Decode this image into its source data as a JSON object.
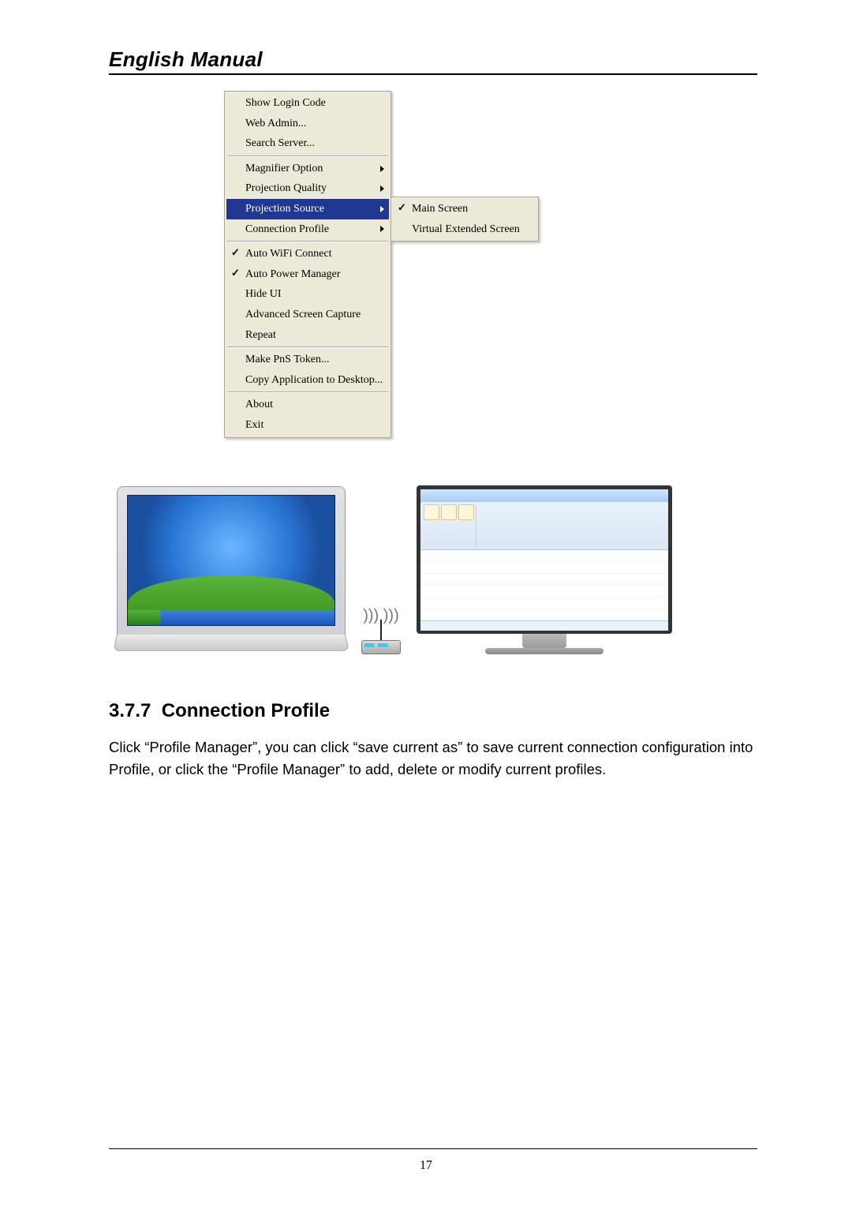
{
  "header": {
    "title": "English Manual"
  },
  "menu": {
    "items": [
      {
        "kind": "item",
        "label": "Show Login Code",
        "checked": false,
        "arrow": false,
        "highlight": false
      },
      {
        "kind": "item",
        "label": "Web Admin...",
        "checked": false,
        "arrow": false,
        "highlight": false
      },
      {
        "kind": "item",
        "label": "Search Server...",
        "checked": false,
        "arrow": false,
        "highlight": false
      },
      {
        "kind": "sep"
      },
      {
        "kind": "item",
        "label": "Magnifier Option",
        "checked": false,
        "arrow": true,
        "highlight": false
      },
      {
        "kind": "item",
        "label": "Projection Quality",
        "checked": false,
        "arrow": true,
        "highlight": false
      },
      {
        "kind": "item",
        "label": "Projection Source",
        "checked": false,
        "arrow": true,
        "highlight": true
      },
      {
        "kind": "item",
        "label": "Connection Profile",
        "checked": false,
        "arrow": true,
        "highlight": false
      },
      {
        "kind": "sep"
      },
      {
        "kind": "item",
        "label": "Auto WiFi Connect",
        "checked": true,
        "arrow": false,
        "highlight": false
      },
      {
        "kind": "item",
        "label": "Auto Power Manager",
        "checked": true,
        "arrow": false,
        "highlight": false
      },
      {
        "kind": "item",
        "label": "Hide UI",
        "checked": false,
        "arrow": false,
        "highlight": false
      },
      {
        "kind": "item",
        "label": "Advanced Screen Capture",
        "checked": false,
        "arrow": false,
        "highlight": false
      },
      {
        "kind": "item",
        "label": "Repeat",
        "checked": false,
        "arrow": false,
        "highlight": false
      },
      {
        "kind": "sep"
      },
      {
        "kind": "item",
        "label": "Make PnS Token...",
        "checked": false,
        "arrow": false,
        "highlight": false
      },
      {
        "kind": "item",
        "label": "Copy Application to Desktop...",
        "checked": false,
        "arrow": false,
        "highlight": false
      },
      {
        "kind": "sep"
      },
      {
        "kind": "item",
        "label": "About",
        "checked": false,
        "arrow": false,
        "highlight": false
      },
      {
        "kind": "item",
        "label": "Exit",
        "checked": false,
        "arrow": false,
        "highlight": false
      }
    ],
    "submenu_items": [
      {
        "label": "Main Screen",
        "checked": true
      },
      {
        "label": "Virtual Extended Screen",
        "checked": false
      }
    ]
  },
  "illustration": {
    "laptop_os": "Windows XP desktop",
    "router_alt": "wireless-router",
    "monitor_app": "spreadsheet application"
  },
  "section": {
    "number": "3.7.7",
    "title": "Connection Profile",
    "body": "Click “Profile Manager”, you can click “save current as” to save current connection configuration into Profile, or click the “Profile Manager” to add, delete or modify current profiles."
  },
  "page_number": "17"
}
